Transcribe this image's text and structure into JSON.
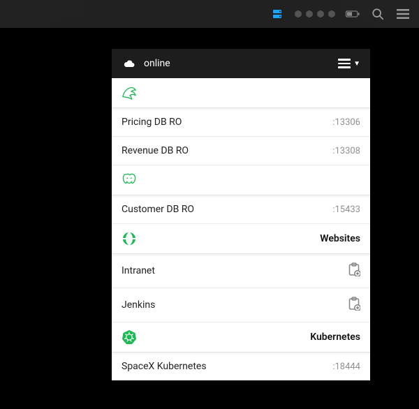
{
  "topbar": {
    "server_icon": "server-icon",
    "search_icon": "search-icon",
    "menu_icon": "hamburger-icon",
    "battery_icon": "battery-icon"
  },
  "panel": {
    "header": {
      "status": "online",
      "menu_icon": "list-menu"
    },
    "groups": [
      {
        "icon": "mysql-dolphin-icon",
        "label": "",
        "items": [
          {
            "name": "Pricing DB RO",
            "port": ":13306",
            "action": null
          },
          {
            "name": "Revenue DB RO",
            "port": ":13308",
            "action": null
          }
        ]
      },
      {
        "icon": "postgres-elephant-icon",
        "label": "",
        "items": [
          {
            "name": "Customer DB RO",
            "port": ":15433",
            "action": null
          }
        ]
      },
      {
        "icon": "globe-icon",
        "label": "Websites",
        "items": [
          {
            "name": "Intranet",
            "port": "",
            "action": "clipboard-add-icon"
          },
          {
            "name": "Jenkins",
            "port": "",
            "action": "clipboard-add-icon"
          }
        ]
      },
      {
        "icon": "kubernetes-icon",
        "label": "Kubernetes",
        "items": [
          {
            "name": "SpaceX Kubernetes",
            "port": ":18444",
            "action": null
          }
        ]
      }
    ]
  },
  "colors": {
    "accent": "#1db954",
    "top_accent": "#1aa6ff"
  }
}
